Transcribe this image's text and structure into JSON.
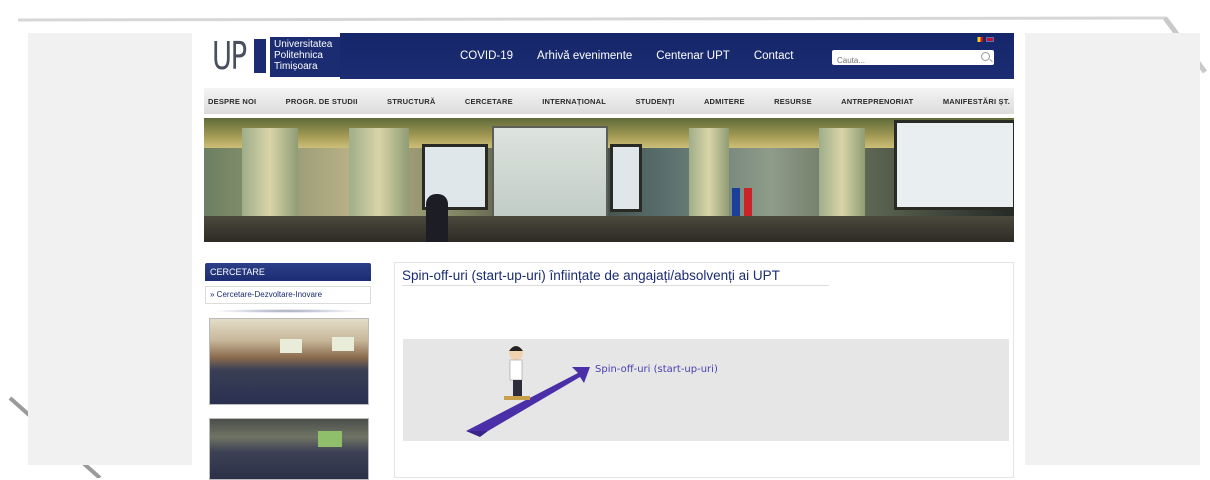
{
  "header": {
    "logo_mark": "UP",
    "logo_lines": [
      "Universitatea",
      "Politehnica",
      "Timișoara"
    ],
    "top_nav": [
      "COVID-19",
      "Arhivă evenimente",
      "Centenar UPT",
      "Contact"
    ],
    "search_placeholder": "Cauta..."
  },
  "main_nav": [
    "DESPRE NOI",
    "PROGR. DE STUDII",
    "STRUCTURĂ",
    "CERCETARE",
    "INTERNAȚIONAL",
    "STUDENȚI",
    "ADMITERE",
    "RESURSE",
    "ANTREPRENORIAT",
    "MANIFESTĂRI ȘT."
  ],
  "sidebar": {
    "heading": "CERCETARE",
    "link": "» Cercetare-Dezvoltare-Inovare"
  },
  "content": {
    "title": "Spin-off-uri (start-up-uri) înființate de angajați/absolvenți ai UPT",
    "promo_label": "Spin-off-uri (start-up-uri)"
  },
  "colors": {
    "navy": "#1b2c72",
    "panel": "#f1f1f1",
    "promo_bg": "#e6e6e6",
    "arrow": "#4a2fa8"
  }
}
